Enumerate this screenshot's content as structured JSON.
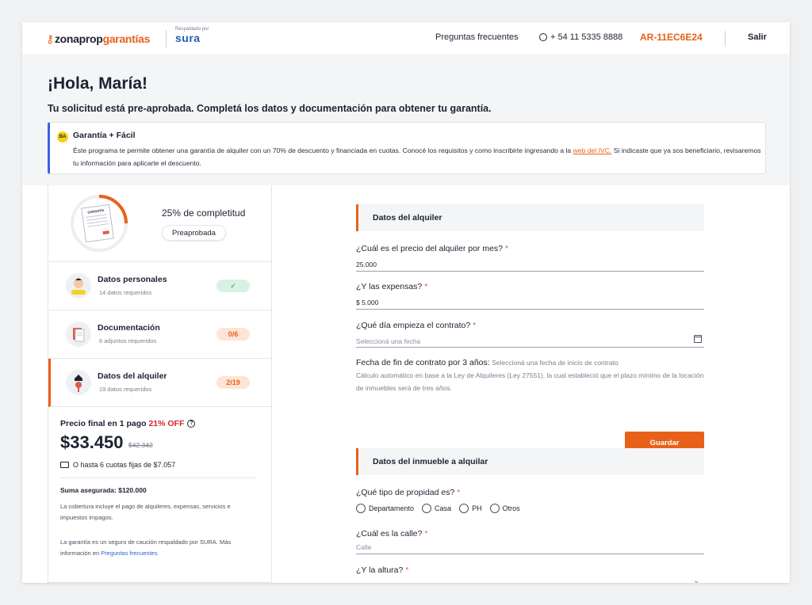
{
  "header": {
    "logo_part1": "zonaprop",
    "logo_part2": "garantías",
    "backed_by": "Respaldado por",
    "sura": "sura",
    "faq": "Preguntas frecuentes",
    "phone": "+ 54 11 5335 8888",
    "code": "AR-11EC6E24",
    "exit": "Salir"
  },
  "greeting": {
    "title": "¡Hola, María!",
    "subtitle": "Tu solicitud está pre-aprobada. Completá los datos y documentación para obtener tu garantía."
  },
  "info": {
    "badge": "BA",
    "title": "Garantía + Fácil",
    "text_before": "Éste programa te permite obtener una garantía de alquiler con un 70% de descuento y financiada en cuotas. Conocé los requisitos y como inscribirte ingresando a la ",
    "link": "web del IVC.",
    "text_after": " Si indicaste que ya sos beneficiario, revisaremos tu información para aplicarte el descuento."
  },
  "progress": {
    "doc_title": "GARANTÍA",
    "percent_text": "25% de completitud",
    "status": "Preaprobada",
    "value": 0.25
  },
  "steps": [
    {
      "title": "Datos personales",
      "sub": "14 datos requeridos",
      "badge": "✓"
    },
    {
      "title": "Documentación",
      "sub": "6 adjuntos requeridos",
      "badge": "0/6"
    },
    {
      "title": "Datos del alquiler",
      "sub": "19 datos requeridos",
      "badge": "2/19"
    }
  ],
  "pricing": {
    "head": "Precio final en 1 pago",
    "off": "21% OFF",
    "help": "?",
    "price": "$33.450",
    "old_price": "$42.342",
    "installments": "O hasta 6 cuotas fijas de $7.057",
    "sum": "Suma asegurada: $120.000",
    "coverage": "La cobertura incluye el pago de alquileres, expensas, servicios e impuestos impagos.",
    "note_before": "La garantía es un seguro de caución respaldado por SURA. Más información en ",
    "note_link": "Preguntas frecuentes"
  },
  "form": {
    "section1": "Datos del alquiler",
    "q_price": "¿Cuál es el precio del alquiler por mes?",
    "v_price": "25.000",
    "q_expenses": "¿Y las expensas?",
    "v_expenses": "$ 5.000",
    "q_start": "¿Qué día empieza el contrato?",
    "p_start": "Seleccioná una fecha",
    "q_end_label": "Fecha de fin de contrato por 3 años:",
    "q_end_hint": " Seleccioná una fecha de inicio de contrato",
    "calc_text": "Cálculo automático en base a la Ley de Alquileres (Ley 27551), la cual estableció que el plazo mínimo de la locación de inmuebles será de tres años.",
    "save": "Guardar",
    "section2": "Datos del inmueble a alquilar",
    "q_type": "¿Qué tipo de propidad es?",
    "options": [
      "Departamento",
      "Casa",
      "PH",
      "Otros"
    ],
    "q_street": "¿Cuál es la calle?",
    "p_street": "Calle",
    "q_height": "¿Y la altura?",
    "req": "*"
  },
  "colors": {
    "accent": "#e8611a",
    "info_border": "#3a62e0",
    "success": "#1f9a4a",
    "discount": "#d8242e"
  }
}
